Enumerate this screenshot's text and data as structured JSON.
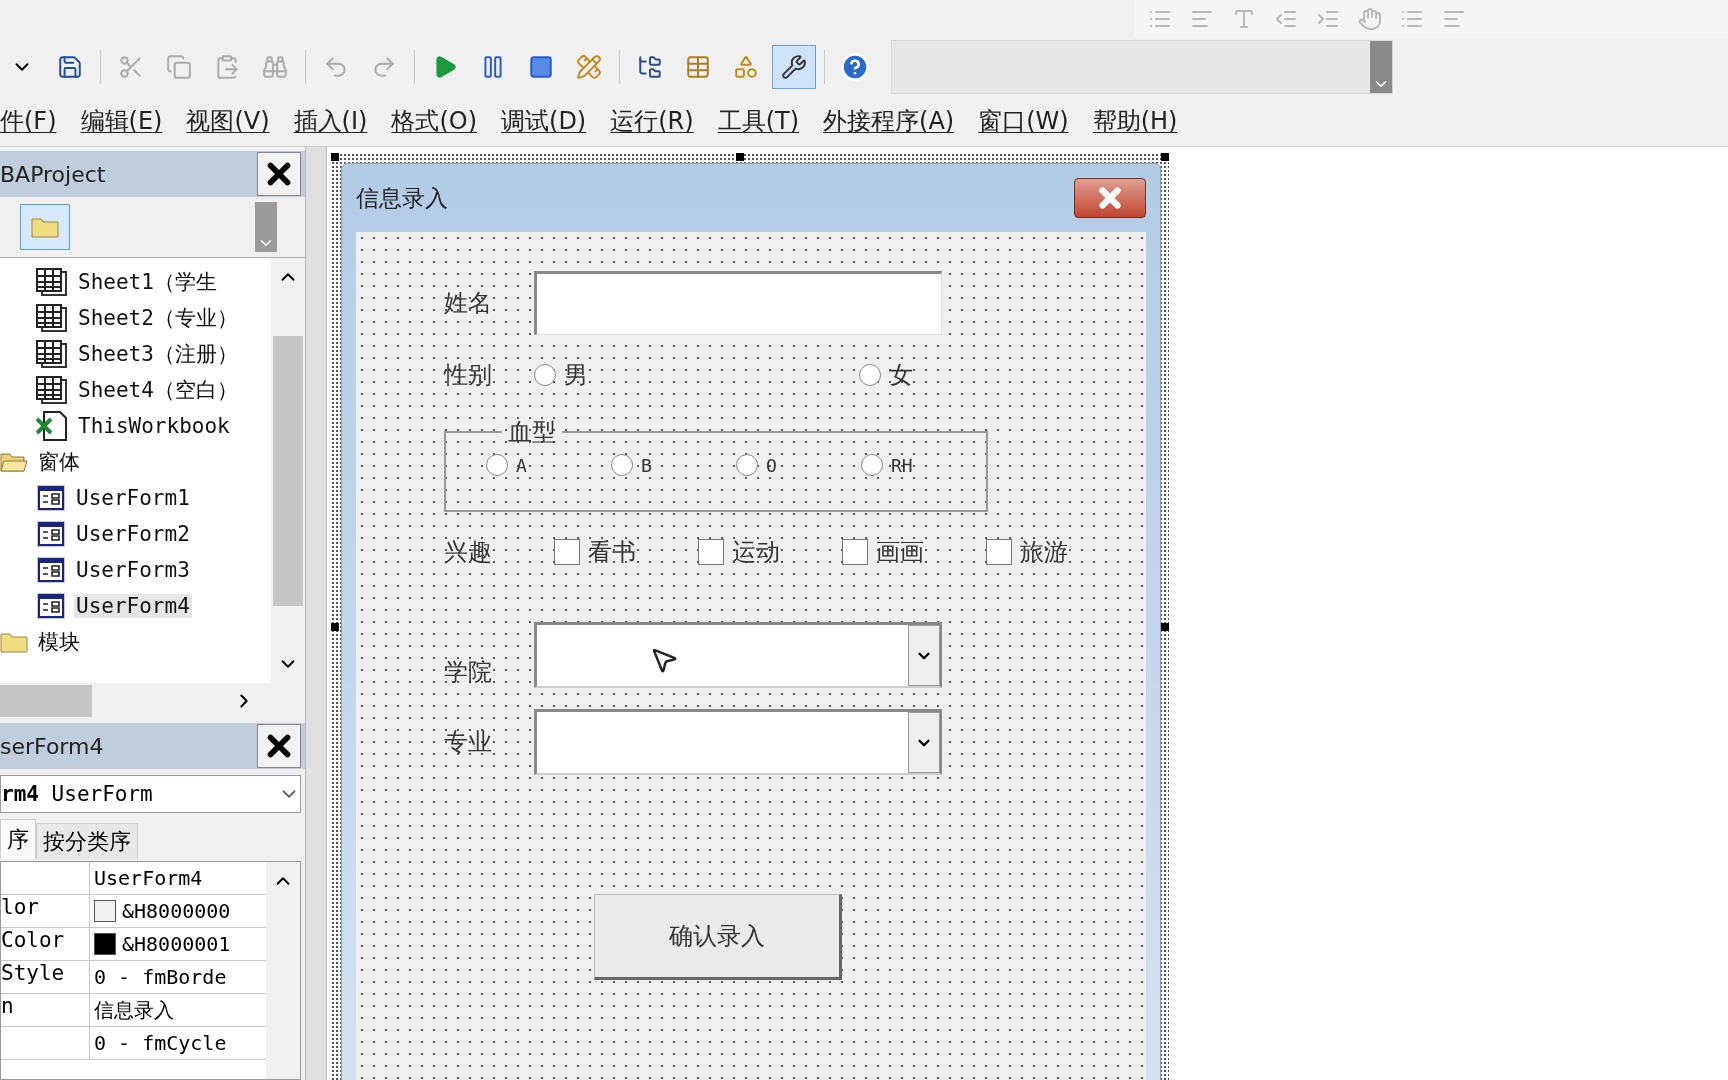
{
  "toolbar": {
    "design_mode_on": true
  },
  "menu": [
    {
      "label": "件(F)"
    },
    {
      "label": "编辑(E)"
    },
    {
      "label": "视图(V)"
    },
    {
      "label": "插入(I)"
    },
    {
      "label": "格式(O)"
    },
    {
      "label": "调试(D)"
    },
    {
      "label": "运行(R)"
    },
    {
      "label": "工具(T)"
    },
    {
      "label": "外接程序(A)"
    },
    {
      "label": "窗口(W)"
    },
    {
      "label": "帮助(H)"
    }
  ],
  "project_panel": {
    "title": "BAProject",
    "tree": [
      {
        "children": [
          {
            "kind": "sheet",
            "label": "Sheet1（学生",
            "selected": false
          },
          {
            "kind": "sheet",
            "label": "Sheet2（专业）",
            "selected": false
          },
          {
            "kind": "sheet",
            "label": "Sheet3（注册）",
            "selected": false
          },
          {
            "kind": "sheet",
            "label": "Sheet4（空白）",
            "selected": false
          },
          {
            "kind": "workbook",
            "label": "ThisWorkbook",
            "selected": false
          }
        ]
      },
      {
        "kind": "folder",
        "label": "窗体",
        "expanded": true,
        "selected": false,
        "children": [
          {
            "kind": "form",
            "label": "UserForm1",
            "selected": false
          },
          {
            "kind": "form",
            "label": "UserForm2",
            "selected": false
          },
          {
            "kind": "form",
            "label": "UserForm3",
            "selected": false
          },
          {
            "kind": "form",
            "label": "UserForm4",
            "selected": true
          }
        ]
      },
      {
        "kind": "folder",
        "label": "模块",
        "expanded": false,
        "selected": false
      }
    ]
  },
  "properties_panel": {
    "title": "serForm4",
    "object_name": "rm4",
    "object_type": "UserForm",
    "tabs": [
      {
        "label": "序",
        "selected": true
      },
      {
        "label": "按分类序",
        "selected": false
      }
    ],
    "rows": [
      {
        "value": "UserForm4"
      },
      {
        "name": "lor",
        "color": "#f0f0f0",
        "value": "&H8000000"
      },
      {
        "name": "Color",
        "color": "#000000",
        "value": "&H8000001"
      },
      {
        "name": "Style",
        "value": "0 - fmBorde"
      },
      {
        "name": "n",
        "value": "信息录入"
      },
      {
        "value": "0 - fmCycle"
      }
    ]
  },
  "form": {
    "title": "信息录入",
    "name_label": "姓名",
    "gender": {
      "label": "性别",
      "options": [
        {
          "label": "男",
          "checked": false
        },
        {
          "label": "女",
          "checked": false
        }
      ]
    },
    "blood_type": {
      "label": "血型",
      "options": [
        {
          "label": "A",
          "checked": false
        },
        {
          "label": "B",
          "checked": false
        },
        {
          "label": "O",
          "checked": false
        },
        {
          "label": "RH",
          "checked": false
        }
      ]
    },
    "interests": {
      "label": "兴趣",
      "options": [
        {
          "label": "看书",
          "checked": false
        },
        {
          "label": "运动",
          "checked": false
        },
        {
          "label": "画画",
          "checked": false
        },
        {
          "label": "旅游",
          "checked": false
        }
      ]
    },
    "college_label": "学院",
    "major_label": "专业",
    "submit": "确认录入"
  }
}
